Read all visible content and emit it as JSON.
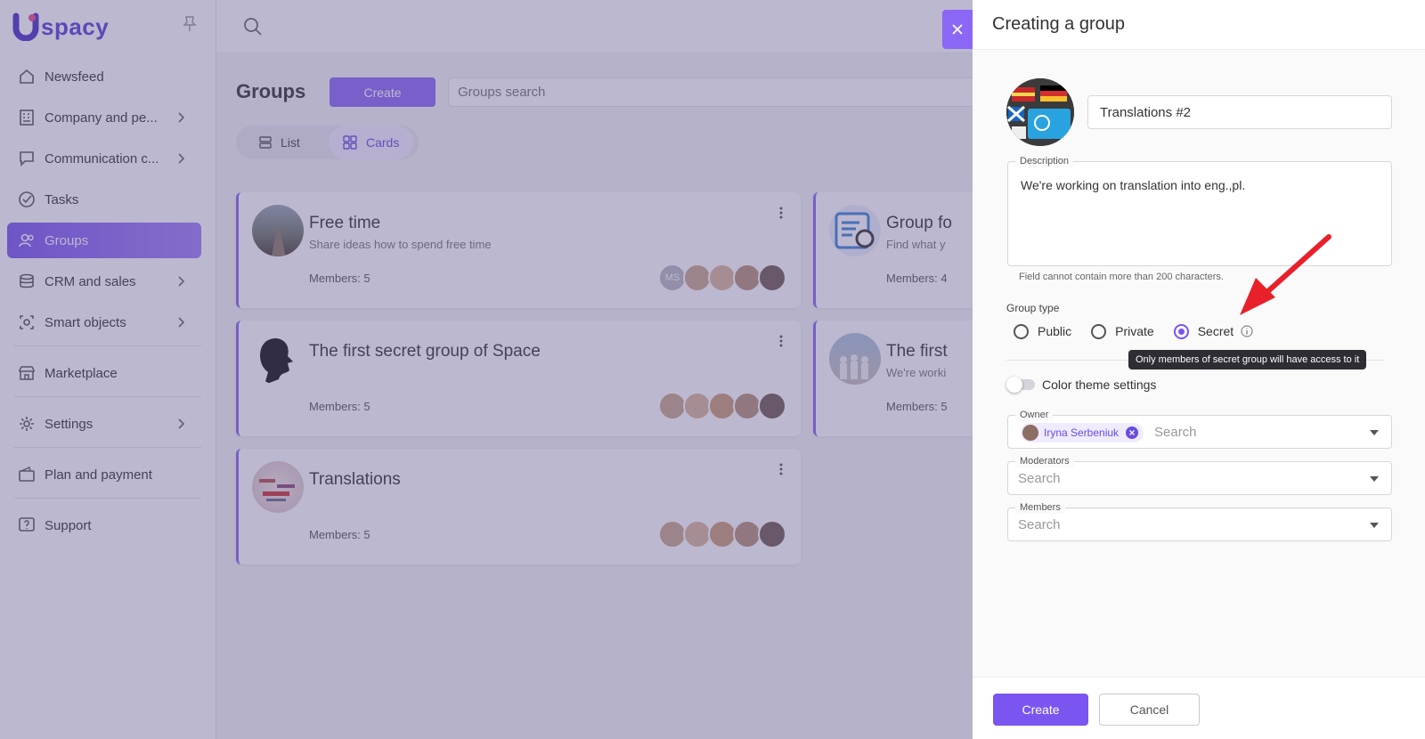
{
  "sidebar": {
    "logo_text": "spacy",
    "items": [
      {
        "label": "Newsfeed",
        "icon": "home-icon"
      },
      {
        "label": "Company and pe...",
        "icon": "building-icon"
      },
      {
        "label": "Communication c...",
        "icon": "chat-icon"
      },
      {
        "label": "Tasks",
        "icon": "check-circle-icon"
      },
      {
        "label": "Groups",
        "icon": "users-icon",
        "active": true
      },
      {
        "label": "CRM and sales",
        "icon": "database-icon"
      },
      {
        "label": "Smart objects",
        "icon": "smart-object-icon"
      },
      {
        "label": "Marketplace",
        "icon": "store-icon"
      },
      {
        "label": "Settings",
        "icon": "gear-icon"
      },
      {
        "label": "Plan and payment",
        "icon": "wallet-icon"
      },
      {
        "label": "Support",
        "icon": "help-icon"
      }
    ]
  },
  "main": {
    "title": "Groups",
    "create_label": "Create",
    "search_placeholder": "Groups search",
    "view_list": "List",
    "view_cards": "Cards",
    "cards": [
      {
        "title": "Free time",
        "description": "Share ideas how to spend free time",
        "members": "Members: 5",
        "initials": "MS"
      },
      {
        "title": "The first secret group of Space",
        "description": "",
        "members": "Members: 5"
      },
      {
        "title": "Translations",
        "description": "",
        "members": "Members: 5"
      },
      {
        "title": "Group fo",
        "description": "Find what y",
        "members": "Members: 4"
      },
      {
        "title": "The first",
        "description": "We're worki",
        "members": "Members: 5"
      }
    ]
  },
  "drawer": {
    "title": "Creating a group",
    "name_value": "Translations #2",
    "description_label": "Description",
    "description_value": "We're working on translation into eng.,pl.",
    "description_hint": "Field cannot contain more than 200 characters.",
    "group_type_label": "Group type",
    "group_types": [
      "Public",
      "Private",
      "Secret"
    ],
    "selected_type": "Secret",
    "tooltip": "Only members of secret group will have access to it",
    "color_theme_label": "Color theme settings",
    "owner_label": "Owner",
    "owner_name": "Iryna Serbeniuk",
    "search_placeholder": "Search",
    "moderators_label": "Moderators",
    "members_label": "Members",
    "create_button": "Create",
    "cancel_button": "Cancel"
  },
  "colors": {
    "accent": "#7a55f0",
    "annotation_arrow": "#e8202a"
  }
}
